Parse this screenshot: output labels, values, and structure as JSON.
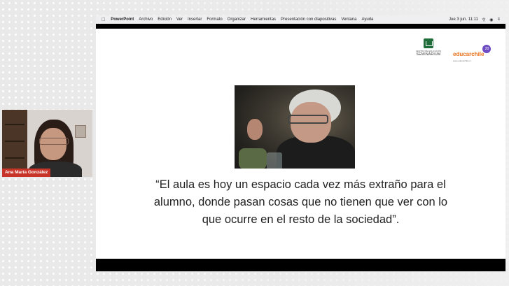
{
  "menubar": {
    "app_name": "PowerPoint",
    "menus": [
      "Archivo",
      "Edición",
      "Ver",
      "Insertar",
      "Formato",
      "Organizar",
      "Herramientas",
      "Presentación con diapositivas",
      "Ventana",
      "Ayuda"
    ],
    "datetime": "Jue 3 jun.  11:11"
  },
  "slide": {
    "logo_seminarium_name": "SEMINARIUM",
    "logo_seminarium_tagline": "CENTRO DE EDUCACIÓN",
    "logo_educarchile_name": "educarchile",
    "logo_educarchile_badge": "20",
    "logo_educarchile_url": "www.educarchile.cl",
    "quote_lines": [
      "“El aula es hoy un espacio cada vez más extraño para el",
      "alumno, donde pasan cosas que no tienen que ver con lo",
      "que ocurre en el resto de la sociedad”."
    ]
  },
  "webcam": {
    "participant_name": "Ana María González",
    "label_color": "#c8342a"
  },
  "colors": {
    "slide_bg": "#ffffff",
    "menubar_bg": "#efeff1",
    "educarchile_orange": "#e8731f",
    "seminarium_green": "#1f6b3a"
  }
}
